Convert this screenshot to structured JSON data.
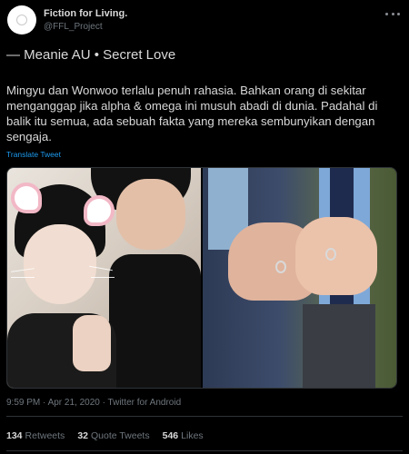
{
  "author": {
    "display_name": "Fiction for Living.",
    "handle": "@FFL_Project"
  },
  "tweet": {
    "heading": "— Meanie AU • Secret Love",
    "body": "Mingyu dan Wonwoo terlalu penuh rahasia. Bahkan orang di sekitar menganggap jika alpha & omega ini musuh abadi di dunia. Padahal di balik itu semua, ada sebuah fakta yang mereka sembunyikan dengan sengaja.",
    "translate_label": "Translate Tweet",
    "timestamp": "9:59 PM · Apr 21, 2020 · Twitter for Android"
  },
  "stats": {
    "retweets_count": "134",
    "retweets_label": "Retweets",
    "quotes_count": "32",
    "quotes_label": "Quote Tweets",
    "likes_count": "546",
    "likes_label": "Likes"
  },
  "colors": {
    "background": "#000000",
    "text": "#d9d9d9",
    "muted": "#6e767d",
    "link": "#1d9bf0",
    "border": "#2f3336"
  }
}
